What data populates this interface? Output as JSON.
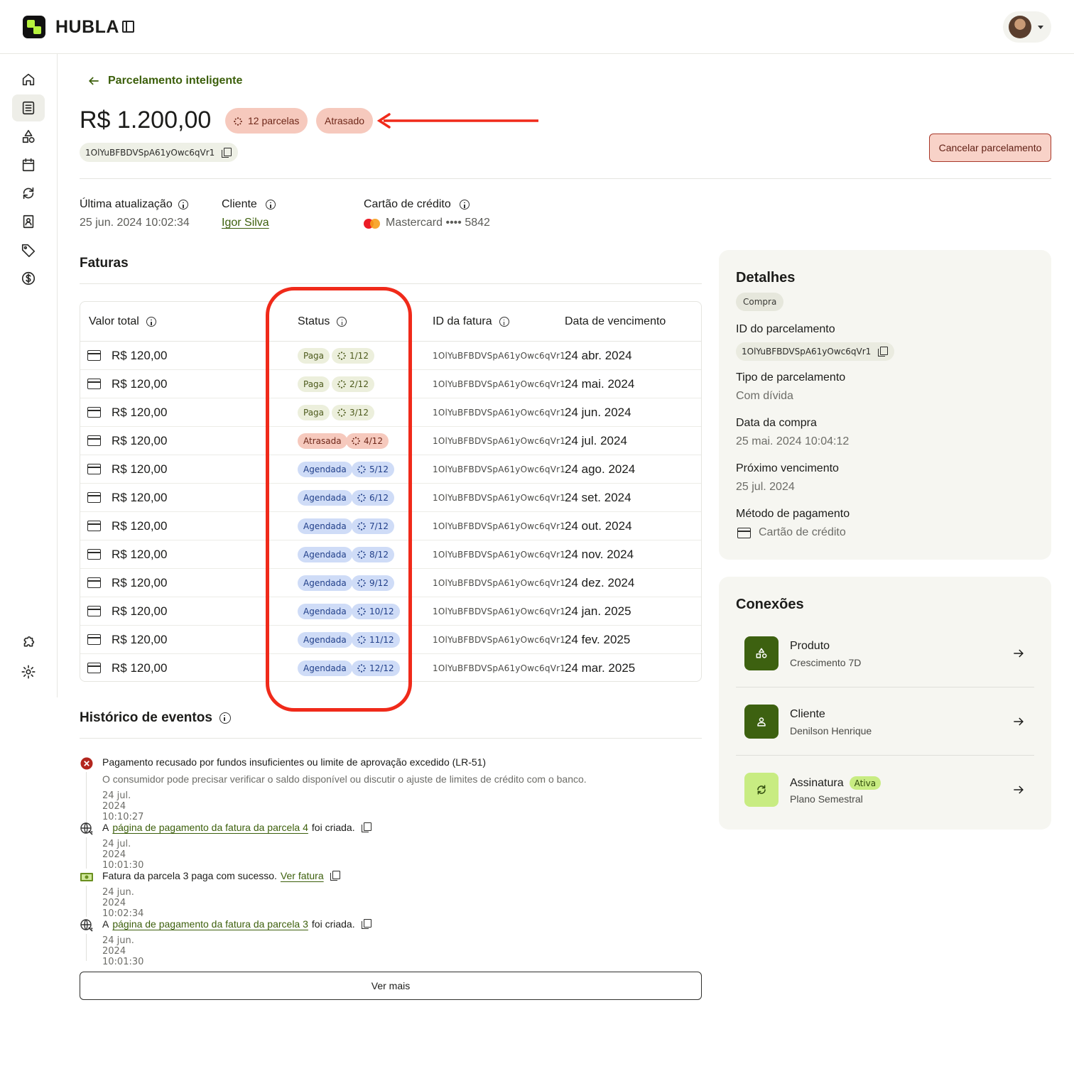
{
  "app": {
    "logo_text": "HUBLA"
  },
  "header": {
    "back_label": "Parcelamento inteligente",
    "amount": "R$ 1.200,00",
    "installments_badge": "12 parcelas",
    "status_badge": "Atrasado",
    "installment_id": "1OlYuBFBDVSpA61yOwc6qVr1",
    "cancel_label": "Cancelar parcelamento"
  },
  "meta": {
    "last_update_label": "Última atualização",
    "last_update_value": "25 jun. 2024 10:02:34",
    "client_label": "Cliente",
    "client_value": "Igor Silva",
    "card_label": "Cartão de crédito",
    "card_value": "Mastercard •••• 5842"
  },
  "invoices": {
    "title": "Faturas",
    "columns": [
      "Valor total",
      "Status",
      "ID da fatura",
      "Data de vencimento"
    ],
    "rows": [
      {
        "amount": "R$ 120,00",
        "status": "Paga",
        "kind": "paid",
        "installment": "1/12",
        "id": "1OlYuBFBDVSpA61yOwc6qVr1",
        "due": "24 abr. 2024"
      },
      {
        "amount": "R$ 120,00",
        "status": "Paga",
        "kind": "paid",
        "installment": "2/12",
        "id": "1OlYuBFBDVSpA61yOwc6qVr1",
        "due": "24 mai. 2024"
      },
      {
        "amount": "R$ 120,00",
        "status": "Paga",
        "kind": "paid",
        "installment": "3/12",
        "id": "1OlYuBFBDVSpA61yOwc6qVr1",
        "due": "24 jun. 2024"
      },
      {
        "amount": "R$ 120,00",
        "status": "Atrasada",
        "kind": "late",
        "installment": "4/12",
        "id": "1OlYuBFBDVSpA61yOwc6qVr1",
        "due": "24 jul. 2024"
      },
      {
        "amount": "R$ 120,00",
        "status": "Agendada",
        "kind": "sched",
        "installment": "5/12",
        "id": "1OlYuBFBDVSpA61yOwc6qVr1",
        "due": "24 ago. 2024"
      },
      {
        "amount": "R$ 120,00",
        "status": "Agendada",
        "kind": "sched",
        "installment": "6/12",
        "id": "1OlYuBFBDVSpA61yOwc6qVr1",
        "due": "24 set. 2024"
      },
      {
        "amount": "R$ 120,00",
        "status": "Agendada",
        "kind": "sched",
        "installment": "7/12",
        "id": "1OlYuBFBDVSpA61yOwc6qVr1",
        "due": "24 out. 2024"
      },
      {
        "amount": "R$ 120,00",
        "status": "Agendada",
        "kind": "sched",
        "installment": "8/12",
        "id": "1OlYuBFBDVSpA61yOwc6qVr1",
        "due": "24 nov. 2024"
      },
      {
        "amount": "R$ 120,00",
        "status": "Agendada",
        "kind": "sched",
        "installment": "9/12",
        "id": "1OlYuBFBDVSpA61yOwc6qVr1",
        "due": "24 dez. 2024"
      },
      {
        "amount": "R$ 120,00",
        "status": "Agendada",
        "kind": "sched",
        "installment": "10/12",
        "id": "1OlYuBFBDVSpA61yOwc6qVr1",
        "due": "24 jan. 2025"
      },
      {
        "amount": "R$ 120,00",
        "status": "Agendada",
        "kind": "sched",
        "installment": "11/12",
        "id": "1OlYuBFBDVSpA61yOwc6qVr1",
        "due": "24 fev. 2025"
      },
      {
        "amount": "R$ 120,00",
        "status": "Agendada",
        "kind": "sched",
        "installment": "12/12",
        "id": "1OlYuBFBDVSpA61yOwc6qVr1",
        "due": "24 mar. 2025"
      }
    ]
  },
  "events": {
    "title": "Histórico de eventos",
    "items": [
      {
        "icon": "error-circle-icon",
        "title": "Pagamento recusado por fundos insuficientes ou limite de aprovação excedido (LR-51)",
        "desc": "O consumidor pode precisar verificar o saldo disponível ou discutir o ajuste de limites de crédito com o banco.",
        "time": "24 jul. 2024 10:10:27"
      },
      {
        "icon": "globe-icon",
        "prefix": "A",
        "link": "página de pagamento da fatura da parcela 4",
        "suffix": "foi criada.",
        "time": "24 jul. 2024 10:01:30"
      },
      {
        "icon": "money-icon",
        "prefix": "Fatura da parcela 3 paga com sucesso.",
        "link": "Ver fatura",
        "time": "24 jun. 2024 10:02:34"
      },
      {
        "icon": "globe-icon",
        "prefix": "A",
        "link": "página de pagamento da fatura da parcela 3",
        "suffix": "foi criada.",
        "time": "24 jun. 2024 10:01:30"
      }
    ],
    "more_label": "Ver mais"
  },
  "details": {
    "title": "Detalhes",
    "tag": "Compra",
    "id_label": "ID do parcelamento",
    "id_value": "1OlYuBFBDVSpA61yOwc6qVr1",
    "type_label": "Tipo de parcelamento",
    "type_value": "Com dívida",
    "purchase_label": "Data da compra",
    "purchase_value": "25 mai. 2024 10:04:12",
    "next_label": "Próximo vencimento",
    "next_value": "25 jul. 2024",
    "method_label": "Método de pagamento",
    "method_value": "Cartão de crédito"
  },
  "connections": {
    "title": "Conexões",
    "items": [
      {
        "name": "Produto",
        "sub": "Crescimento 7D"
      },
      {
        "name": "Cliente",
        "sub": "Denilson Henrique"
      },
      {
        "name": "Assinatura",
        "badge": "Ativa",
        "sub": "Plano Semestral"
      }
    ]
  },
  "colors": {
    "accent": "#3c5f0b",
    "brand_green": "#b6f23d",
    "late": "#f6c9bd",
    "scheduled": "#cfdcf7",
    "paid": "#ecefdc",
    "highlight": "#f02a1a"
  }
}
